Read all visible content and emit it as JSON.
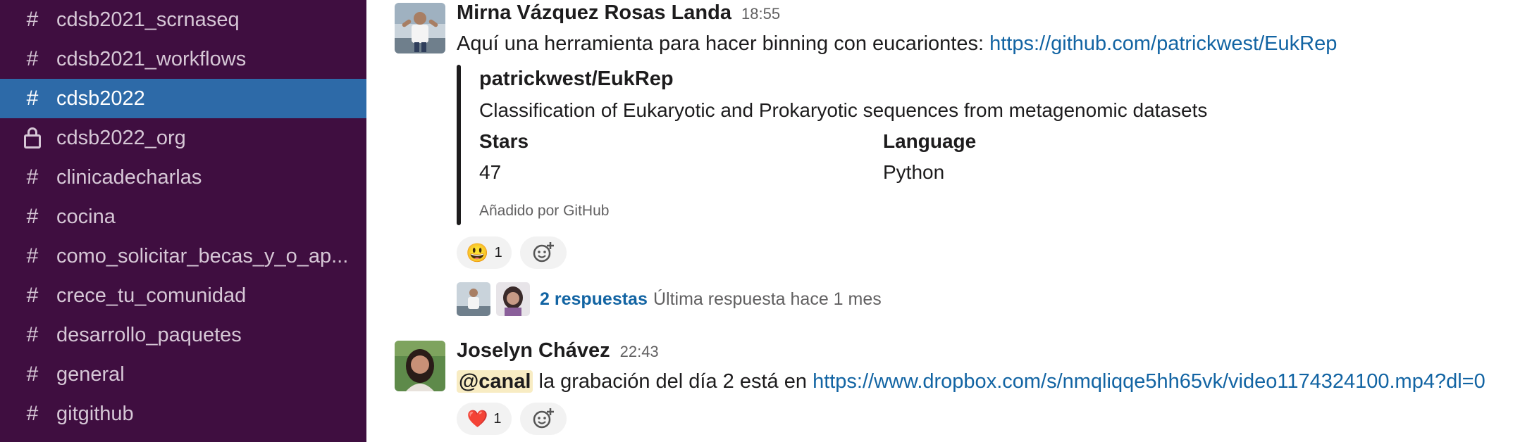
{
  "sidebar": {
    "channels": [
      {
        "name": "cdsb2021_scrnaseq",
        "icon": "hash-icon"
      },
      {
        "name": "cdsb2021_workflows",
        "icon": "hash-icon"
      },
      {
        "name": "cdsb2022",
        "icon": "hash-icon",
        "active": true
      },
      {
        "name": "cdsb2022_org",
        "icon": "lock-icon"
      },
      {
        "name": "clinicadecharlas",
        "icon": "hash-icon"
      },
      {
        "name": "cocina",
        "icon": "hash-icon"
      },
      {
        "name": "como_solicitar_becas_y_o_ap...",
        "icon": "hash-icon"
      },
      {
        "name": "crece_tu_comunidad",
        "icon": "hash-icon"
      },
      {
        "name": "desarrollo_paquetes",
        "icon": "hash-icon"
      },
      {
        "name": "general",
        "icon": "hash-icon"
      },
      {
        "name": "gitgithub",
        "icon": "hash-icon"
      }
    ],
    "hash_glyph": "#"
  },
  "messages": [
    {
      "sender": "Mirna Vázquez Rosas Landa",
      "time": "18:55",
      "text": "Aquí una herramienta para hacer binning con eucariontes: ",
      "link": "https://github.com/patrickwest/EukRep",
      "unfurl": {
        "title": "patrickwest/EukRep",
        "description": "Classification of Eukaryotic and Prokaryotic sequences from metagenomic datasets",
        "fields": [
          {
            "label": "Stars",
            "value": "47"
          },
          {
            "label": "Language",
            "value": "Python"
          }
        ],
        "footer": "Añadido por GitHub"
      },
      "reaction": {
        "emoji": "😃",
        "count": "1"
      },
      "thread": {
        "replies": "2 respuestas",
        "last_reply": "Última respuesta hace 1 mes"
      }
    },
    {
      "sender": "Joselyn Chávez",
      "time": "22:43",
      "mention": "@canal",
      "text": " la grabación del día 2 está en ",
      "link": "https://www.dropbox.com/s/nmqliqqe5hh65vk/video1174324100.mp4?dl=0",
      "reaction": {
        "emoji": "❤️",
        "count": "1"
      }
    }
  ],
  "colors": {
    "sidebar_bg": "#3f0e40",
    "active_channel": "#2d6aa8",
    "link": "#1264a3",
    "mention_bg": "#f8ecc3"
  }
}
